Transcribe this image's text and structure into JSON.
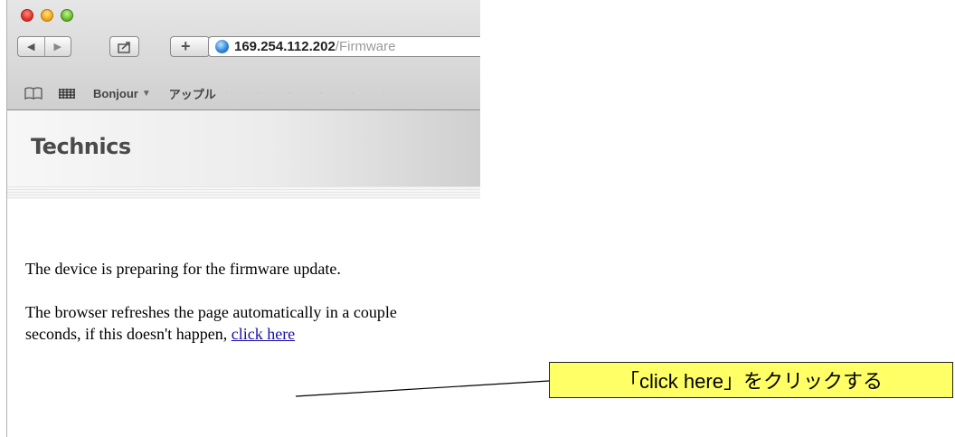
{
  "browser": {
    "url_host": "169.254.112.202",
    "url_path": "/Firmware",
    "bookmarks": {
      "bonjour_label": "Bonjour",
      "caret": "▼",
      "apple_label": "アップル",
      "dots": "· · · · · ·"
    },
    "icons": {
      "back": "◀",
      "forward": "▶",
      "share": "⤴",
      "add": "+",
      "bookmarks_book": "📖"
    }
  },
  "page": {
    "logo": "Technics",
    "para1": "The device is preparing for the firmware update.",
    "para2_text": "The browser refreshes the page automatically in a couple seconds, if this doesn't happen, ",
    "link_text": "click here"
  },
  "callout": {
    "text": "「click here」をクリックする",
    "color": "#ffff66"
  }
}
